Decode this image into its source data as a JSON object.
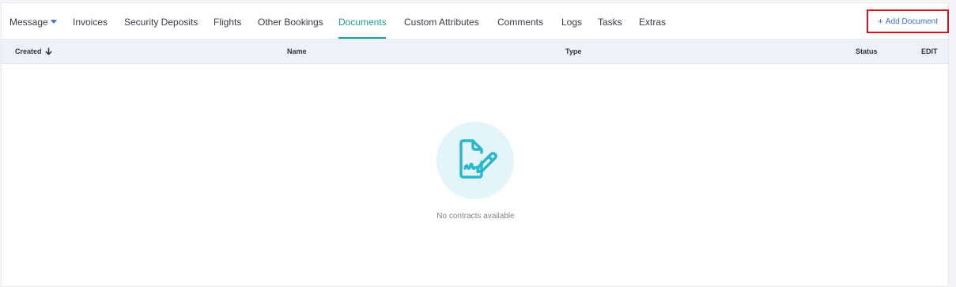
{
  "tabs": {
    "message": "Message",
    "invoices": "Invoices",
    "security_deposits": "Security Deposits",
    "flights": "Flights",
    "other_bookings": "Other Bookings",
    "documents": "Documents",
    "custom_attributes": "Custom Attributes",
    "comments": "Comments",
    "logs": "Logs",
    "tasks": "Tasks",
    "extras": "Extras",
    "active": "Documents"
  },
  "toolbar": {
    "add_document_plus": "+",
    "add_document_label": "Add Document"
  },
  "table": {
    "columns": {
      "created": "Created",
      "name": "Name",
      "type": "Type",
      "status": "Status",
      "edit": "EDIT"
    },
    "sort": {
      "column": "Created",
      "direction": "descending"
    },
    "rows": []
  },
  "empty_state": {
    "icon": "contract-signature-icon",
    "message": "No contracts available"
  },
  "colors": {
    "accent": "#1a9e95",
    "link_blue": "#3f6fce",
    "highlight_border": "#d0101a",
    "empty_icon": "#28b7cc",
    "empty_circle": "#e3f5f8"
  }
}
